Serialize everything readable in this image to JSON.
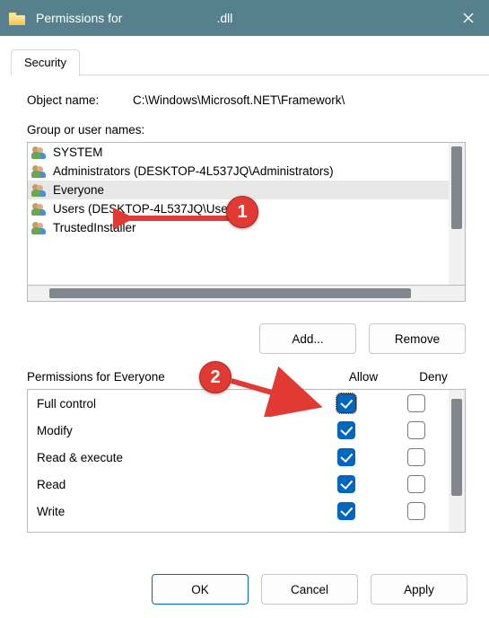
{
  "title": {
    "prefix": "Permissions for",
    "filename": ".dll"
  },
  "tab": "Security",
  "object_name_label": "Object name:",
  "object_name_value": "C:\\Windows\\Microsoft.NET\\Framework\\",
  "groups_label": "Group or user names:",
  "groups": [
    {
      "label": "SYSTEM",
      "selected": false
    },
    {
      "label": "Administrators (DESKTOP-4L537JQ\\Administrators)",
      "selected": false
    },
    {
      "label": "Everyone",
      "selected": true
    },
    {
      "label": "Users (DESKTOP-4L537JQ\\Users)",
      "selected": false
    },
    {
      "label": "TrustedInstaller",
      "selected": false
    }
  ],
  "add_btn": "Add...",
  "remove_btn": "Remove",
  "perm_title": "Permissions for Everyone",
  "allow_h": "Allow",
  "deny_h": "Deny",
  "perms": [
    {
      "name": "Full control",
      "allow": true,
      "deny": false,
      "focus": true
    },
    {
      "name": "Modify",
      "allow": true,
      "deny": false
    },
    {
      "name": "Read & execute",
      "allow": true,
      "deny": false
    },
    {
      "name": "Read",
      "allow": true,
      "deny": false
    },
    {
      "name": "Write",
      "allow": true,
      "deny": false
    }
  ],
  "ok_btn": "OK",
  "cancel_btn": "Cancel",
  "apply_btn": "Apply",
  "annotations": {
    "one": "1",
    "two": "2"
  }
}
